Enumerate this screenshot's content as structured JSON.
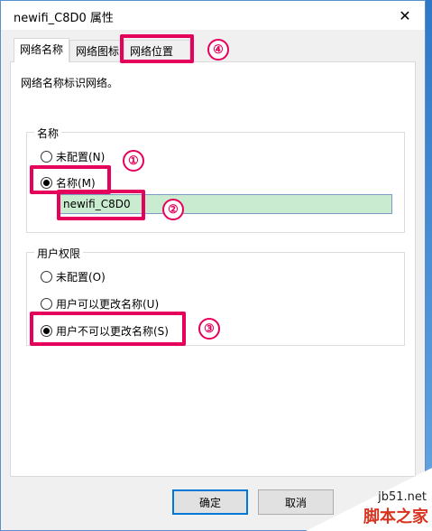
{
  "window": {
    "title": "newifi_C8D0 属性",
    "close_glyph": "✕"
  },
  "tabs": [
    {
      "label": "网络名称",
      "active": true
    },
    {
      "label": "网络图标",
      "active": false
    },
    {
      "label": "网络位置",
      "active": false
    }
  ],
  "description": "网络名称标识网络。",
  "name_group": {
    "legend": "名称",
    "options": [
      {
        "label": "未配置(N)",
        "checked": false
      },
      {
        "label": "名称(M)",
        "checked": true
      }
    ],
    "name_value": "newifi_C8D0"
  },
  "permission_group": {
    "legend": "用户权限",
    "options": [
      {
        "label": "未配置(O)",
        "checked": false
      },
      {
        "label": "用户可以更改名称(U)",
        "checked": false
      },
      {
        "label": "用户不可以更改名称(S)",
        "checked": true
      }
    ]
  },
  "buttons": {
    "ok": "确定",
    "cancel": "取消"
  },
  "callouts": [
    "①",
    "②",
    "③",
    "④"
  ],
  "watermark": {
    "site": "jb51.net",
    "name": "脚本之家"
  },
  "colors": {
    "highlight": "#e5005b",
    "input_bg": "#c9ecd0"
  }
}
